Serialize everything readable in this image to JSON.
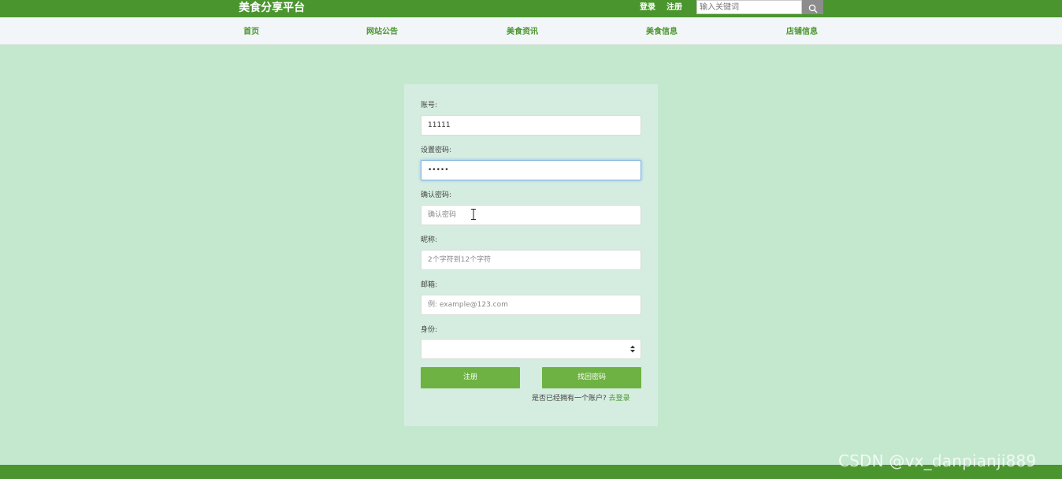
{
  "header": {
    "brand": "美食分享平台",
    "login_link": "登录",
    "register_link": "注册",
    "search": {
      "placeholder": "输入关键词",
      "icon": "search-icon"
    }
  },
  "nav": {
    "items": [
      {
        "label": "首页"
      },
      {
        "label": "网站公告"
      },
      {
        "label": "美食资讯"
      },
      {
        "label": "美食信息"
      },
      {
        "label": "店铺信息"
      }
    ]
  },
  "form": {
    "account": {
      "label": "账号:",
      "value": "11111"
    },
    "password": {
      "label": "设置密码:",
      "value": "•••••"
    },
    "confirm": {
      "label": "确认密码:",
      "placeholder": "确认密码"
    },
    "nickname": {
      "label": "昵称:",
      "placeholder": "2个字符到12个字符"
    },
    "email": {
      "label": "邮箱:",
      "placeholder": "例: example@123.com"
    },
    "identity": {
      "label": "身份:",
      "selected": ""
    },
    "register_button": "注册",
    "recover_button": "找回密码",
    "hint_text": "是否已经拥有一个账户?",
    "hint_link": "去登录"
  },
  "watermark": "CSDN @vx_danpianji889",
  "colors": {
    "brand_green": "#4a952e",
    "button_green": "#6db242",
    "page_bg": "#c3e8ce",
    "panel_bg": "#d5ede0"
  }
}
